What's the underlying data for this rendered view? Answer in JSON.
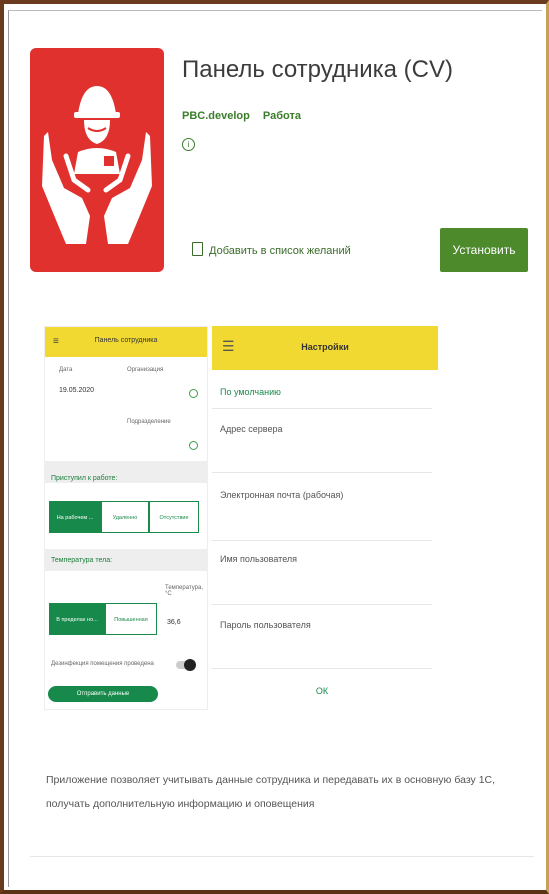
{
  "app": {
    "title": "Панель сотрудника (CV)",
    "developer": "PBC.develop",
    "category": "Работа",
    "info_glyph": "i",
    "wishlist_label": "Добавить в список желаний",
    "install_label": "Установить"
  },
  "colors": {
    "icon_bg": "#e0312f",
    "accent_green": "#4c8a2c",
    "header_yellow": "#f2d931",
    "toggle_green": "#17894a"
  },
  "screenshot1": {
    "menu_icon": "≡",
    "title": "Панель сотрудника",
    "date_label": "Дата",
    "date_value": "19.05.2020",
    "org_label": "Организация",
    "dept_label": "Подразделение",
    "arrival_label": "Приступил к работе:",
    "arrival_options": [
      "На рабочем ...",
      "Удаленно",
      "Отсутствие"
    ],
    "arrival_selected": 0,
    "temp_label": "Температура тела:",
    "temp_options": [
      "В пределах но...",
      "Повышенная"
    ],
    "temp_selected": 0,
    "temp_value_label": "Температура, °C",
    "temp_value": "36,6",
    "disinfection_label": "Дезинфекция помещения проведена",
    "send_button": "Отправить данные"
  },
  "screenshot2": {
    "menu_icon": "☰",
    "title": "Настройки",
    "default_label": "По умолчанию",
    "fields": [
      "Адрес сервера",
      "Электронная почта (рабочая)",
      "Имя пользователя",
      "Пароль пользователя"
    ],
    "ok_label": "ОК"
  },
  "description": "Приложение позволяет учитывать данные сотрудника и передавать их в основную базу 1С, получать дополнительную информацию и оповещения"
}
